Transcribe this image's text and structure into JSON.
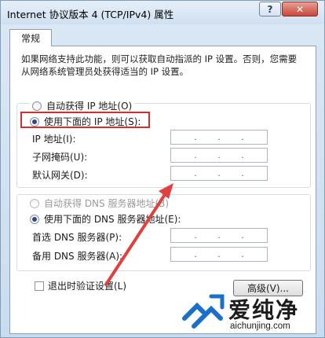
{
  "window": {
    "title": "Internet 协议版本 4 (TCP/IPv4) 属性",
    "help_label": "?",
    "close_label": "✕"
  },
  "tabs": [
    {
      "label": "常规"
    }
  ],
  "description": "如果网络支持此功能，则可以获取自动指派的 IP 设置。否则，您需要从网络系统管理员处获得适当的 IP 设置。",
  "ip_section": {
    "auto_label": "自动获得 IP 地址(O)",
    "auto_selected": false,
    "manual_label": "使用下面的 IP 地址(S):",
    "manual_selected": true,
    "fields": [
      {
        "label": "IP 地址(I):",
        "value": ""
      },
      {
        "label": "子网掩码(U):",
        "value": ""
      },
      {
        "label": "默认网关(D):",
        "value": ""
      }
    ]
  },
  "dns_section": {
    "auto_label": "自动获得 DNS 服务器地址(B)",
    "auto_disabled": true,
    "manual_label": "使用下面的 DNS 服务器地址(E):",
    "manual_selected": true,
    "fields": [
      {
        "label": "首选 DNS 服务器(P):",
        "value": ""
      },
      {
        "label": "备用 DNS 服务器(A):",
        "value": ""
      }
    ]
  },
  "validate_checkbox": {
    "label": "退出时验证设置(L)",
    "checked": false
  },
  "advanced_button": {
    "label": "高级(V)..."
  },
  "ip_separator": ".",
  "watermark": {
    "name": "爱纯净",
    "url": "aichunjing.com"
  },
  "colors": {
    "highlight": "#d62d2d",
    "arrow": "#e04040"
  }
}
